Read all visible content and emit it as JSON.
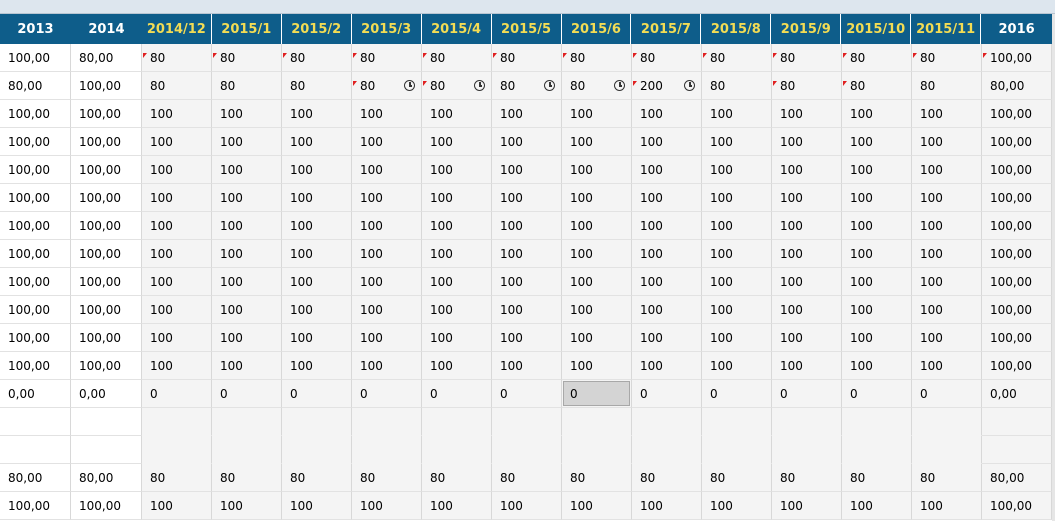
{
  "headers": [
    "2013",
    "2014",
    "2014/12",
    "2015/1",
    "2015/2",
    "2015/3",
    "2015/4",
    "2015/5",
    "2015/6",
    "2015/7",
    "2015/8",
    "2015/9",
    "2015/10",
    "2015/11",
    "2016"
  ],
  "rows": [
    {
      "cells": [
        "100,00",
        "80,00",
        "80",
        "80",
        "80",
        "80",
        "80",
        "80",
        "80",
        "80",
        "80",
        "80",
        "80",
        "80",
        "100,00"
      ],
      "flags": [
        2,
        3,
        4,
        5,
        6,
        7,
        8,
        9,
        10,
        11,
        12,
        13,
        14
      ],
      "clocks": []
    },
    {
      "cells": [
        "80,00",
        "100,00",
        "80",
        "80",
        "80",
        "80",
        "80",
        "80",
        "80",
        "200",
        "80",
        "80",
        "80",
        "80",
        "80,00"
      ],
      "flags": [
        5,
        6,
        9,
        11,
        12
      ],
      "clocks": [
        5,
        6,
        7,
        8,
        9
      ]
    },
    {
      "cells": [
        "100,00",
        "100,00",
        "100",
        "100",
        "100",
        "100",
        "100",
        "100",
        "100",
        "100",
        "100",
        "100",
        "100",
        "100",
        "100,00"
      ]
    },
    {
      "cells": [
        "100,00",
        "100,00",
        "100",
        "100",
        "100",
        "100",
        "100",
        "100",
        "100",
        "100",
        "100",
        "100",
        "100",
        "100",
        "100,00"
      ]
    },
    {
      "cells": [
        "100,00",
        "100,00",
        "100",
        "100",
        "100",
        "100",
        "100",
        "100",
        "100",
        "100",
        "100",
        "100",
        "100",
        "100",
        "100,00"
      ]
    },
    {
      "cells": [
        "100,00",
        "100,00",
        "100",
        "100",
        "100",
        "100",
        "100",
        "100",
        "100",
        "100",
        "100",
        "100",
        "100",
        "100",
        "100,00"
      ]
    },
    {
      "cells": [
        "100,00",
        "100,00",
        "100",
        "100",
        "100",
        "100",
        "100",
        "100",
        "100",
        "100",
        "100",
        "100",
        "100",
        "100",
        "100,00"
      ]
    },
    {
      "cells": [
        "100,00",
        "100,00",
        "100",
        "100",
        "100",
        "100",
        "100",
        "100",
        "100",
        "100",
        "100",
        "100",
        "100",
        "100",
        "100,00"
      ]
    },
    {
      "cells": [
        "100,00",
        "100,00",
        "100",
        "100",
        "100",
        "100",
        "100",
        "100",
        "100",
        "100",
        "100",
        "100",
        "100",
        "100",
        "100,00"
      ]
    },
    {
      "cells": [
        "100,00",
        "100,00",
        "100",
        "100",
        "100",
        "100",
        "100",
        "100",
        "100",
        "100",
        "100",
        "100",
        "100",
        "100",
        "100,00"
      ]
    },
    {
      "cells": [
        "100,00",
        "100,00",
        "100",
        "100",
        "100",
        "100",
        "100",
        "100",
        "100",
        "100",
        "100",
        "100",
        "100",
        "100",
        "100,00"
      ]
    },
    {
      "cells": [
        "100,00",
        "100,00",
        "100",
        "100",
        "100",
        "100",
        "100",
        "100",
        "100",
        "100",
        "100",
        "100",
        "100",
        "100",
        "100,00"
      ]
    },
    {
      "cells": [
        "0,00",
        "0,00",
        "0",
        "0",
        "0",
        "0",
        "0",
        "0",
        "0",
        "0",
        "0",
        "0",
        "0",
        "0",
        "0,00"
      ],
      "selected": 8
    },
    {
      "cells": [
        "",
        "",
        "",
        "",
        "",
        "",
        "",
        "",
        "",
        "",
        "",
        "",
        "",
        "",
        ""
      ],
      "blank": true
    },
    {
      "cells": [
        "",
        "",
        "",
        "",
        "",
        "",
        "",
        "",
        "",
        "",
        "",
        "",
        "",
        "",
        ""
      ],
      "blank": true
    },
    {
      "cells": [
        "80,00",
        "80,00",
        "80",
        "80",
        "80",
        "80",
        "80",
        "80",
        "80",
        "80",
        "80",
        "80",
        "80",
        "80",
        "80,00"
      ]
    },
    {
      "cells": [
        "100,00",
        "100,00",
        "100",
        "100",
        "100",
        "100",
        "100",
        "100",
        "100",
        "100",
        "100",
        "100",
        "100",
        "100",
        "100,00"
      ]
    }
  ],
  "icons": {
    "flag": "changed-flag-icon",
    "clock": "clock-icon"
  },
  "colors": {
    "header_bg": "#0e5d8a",
    "year_text": "#ffffff",
    "month_text": "#f3dc54",
    "flag": "#e02020",
    "selected_cell": "#d4d4d4"
  }
}
